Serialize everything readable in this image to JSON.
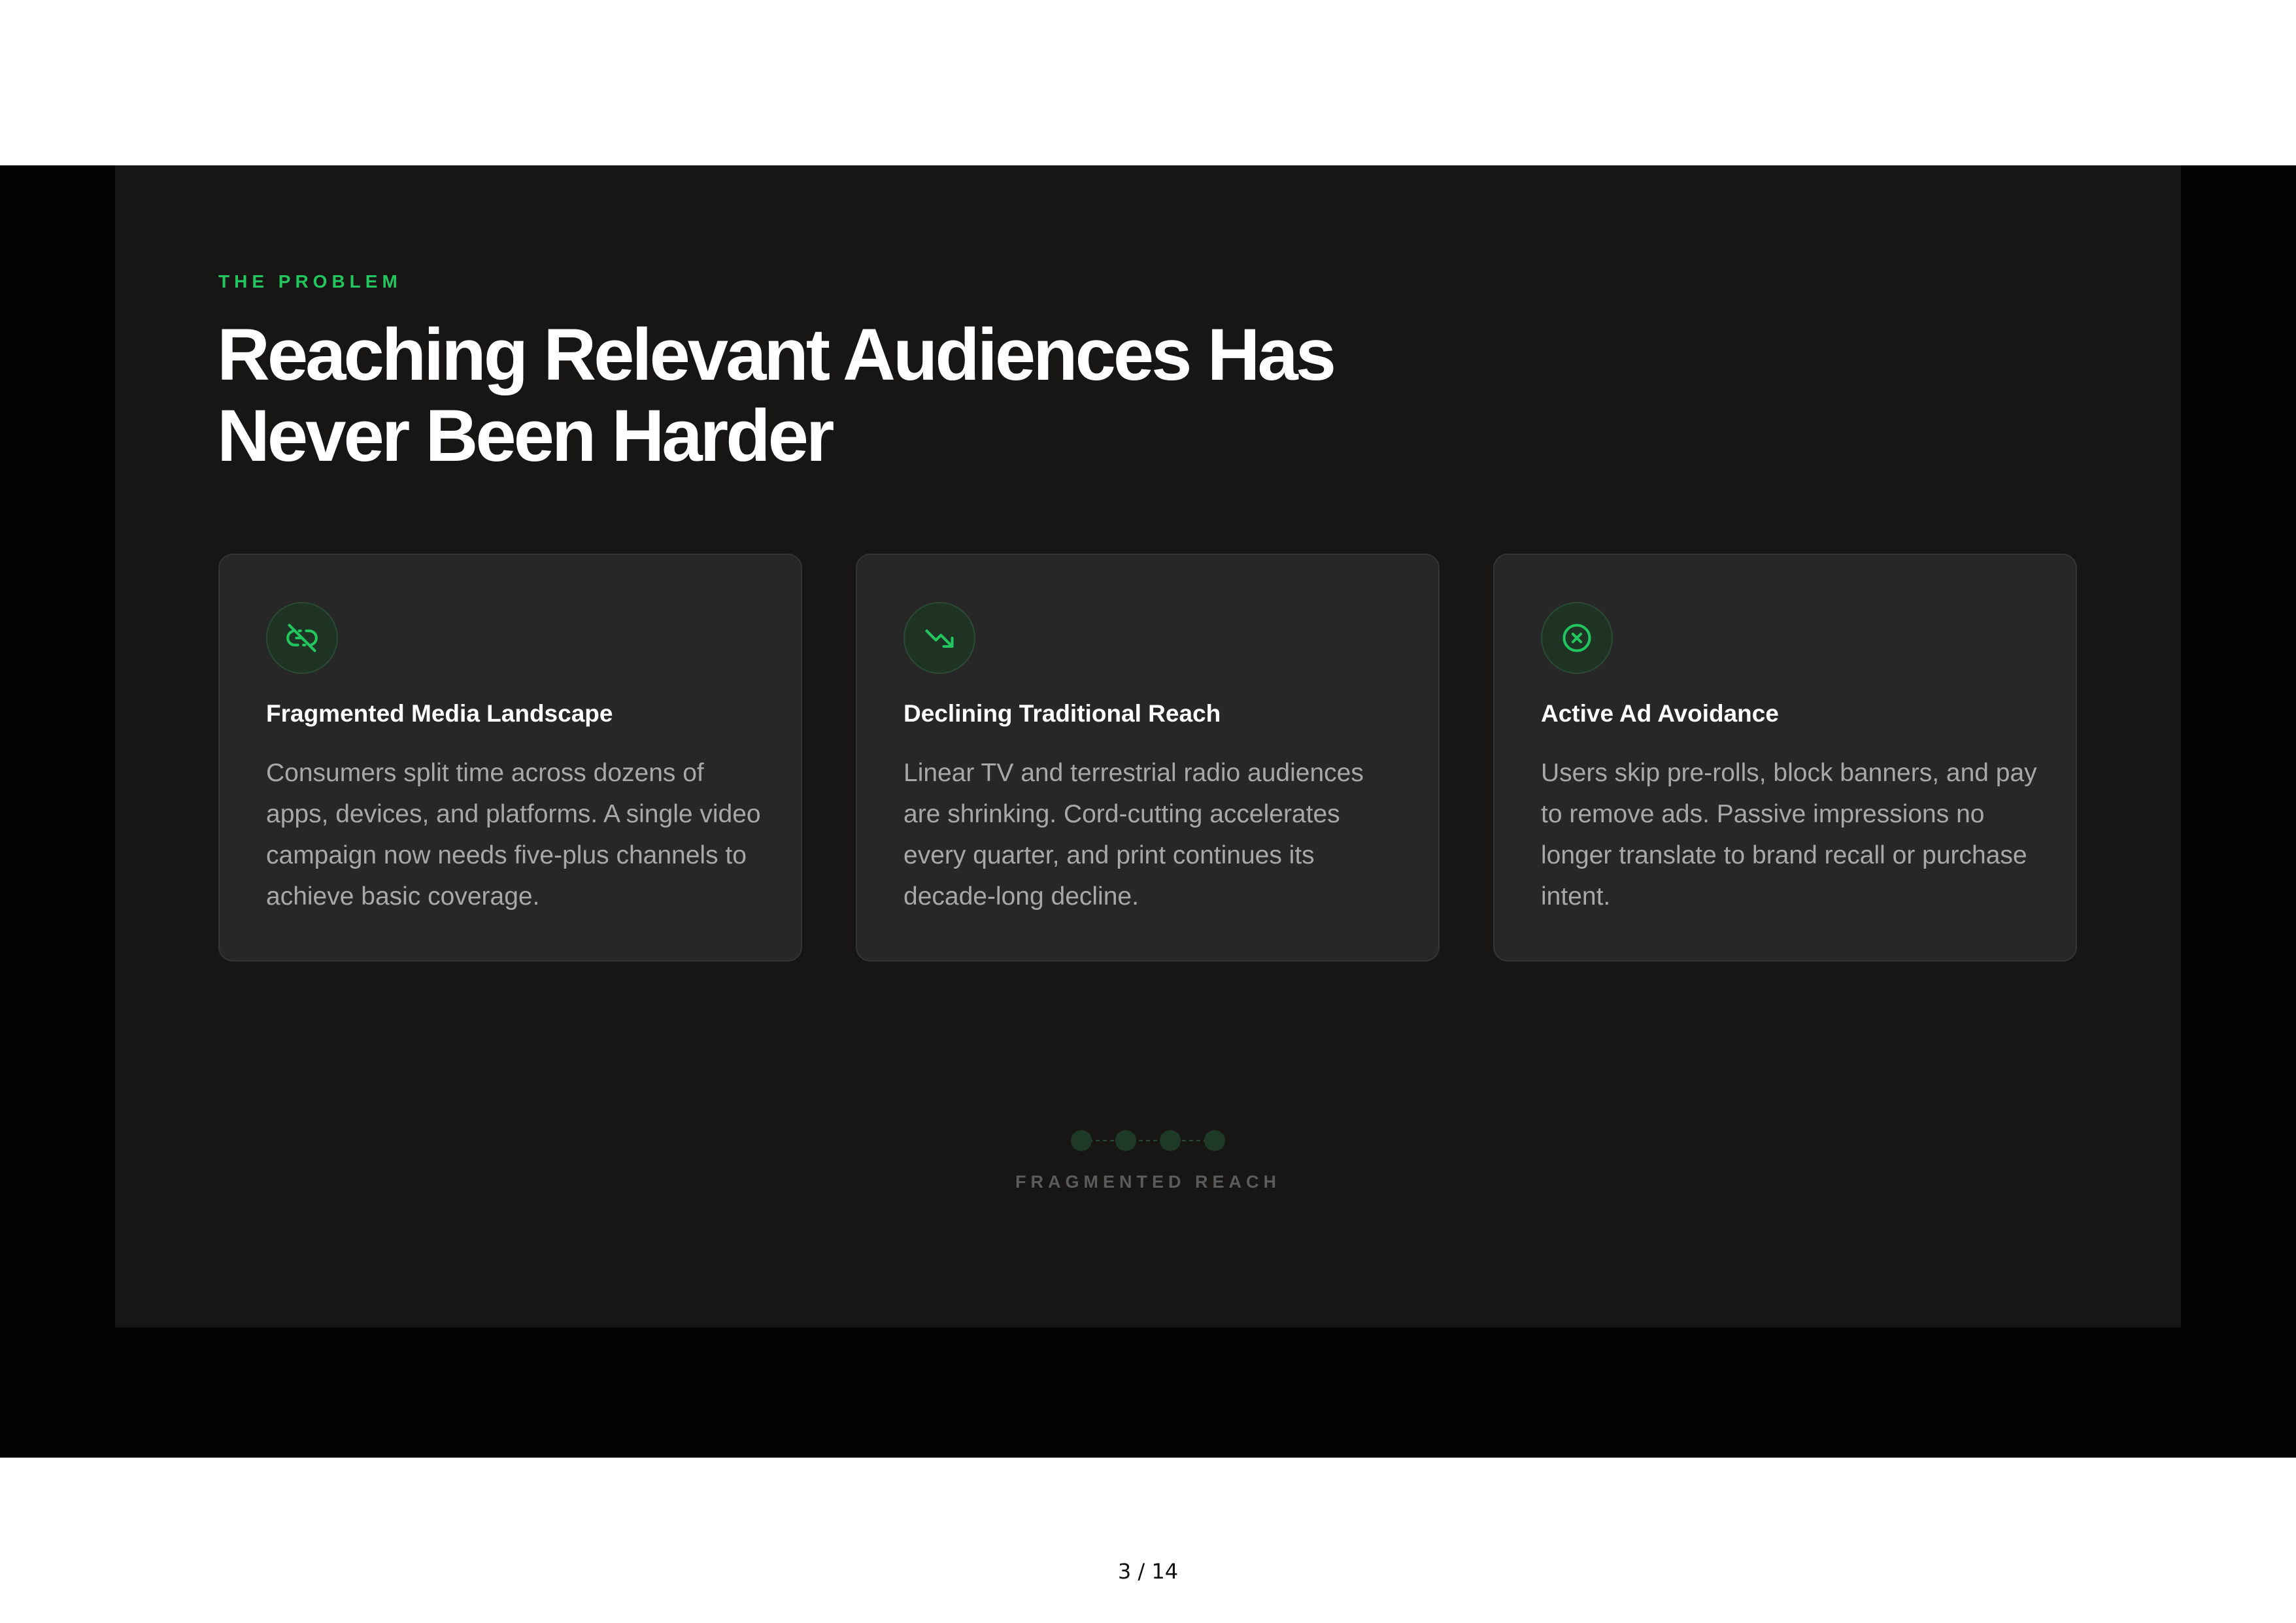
{
  "slide": {
    "eyebrow": "THE PROBLEM",
    "title": "Reaching Relevant Audiences Has Never Been Harder",
    "cards": [
      {
        "icon": "broken-link-icon",
        "title": "Fragmented Media Landscape",
        "body": "Consumers split time across dozens of apps, devices, and platforms. A single video campaign now needs five-plus channels to achieve basic coverage."
      },
      {
        "icon": "trending-down-icon",
        "title": "Declining Traditional Reach",
        "body": "Linear TV and terrestrial radio audiences are shrinking. Cord-cutting accelerates every quarter, and print continues its decade-long decline."
      },
      {
        "icon": "x-circle-icon",
        "title": "Active Ad Avoidance",
        "body": "Users skip pre-rolls, block banners, and pay to remove ads. Passive impressions no longer translate to brand recall or purchase intent."
      }
    ],
    "progress": {
      "label": "FRAGMENTED REACH",
      "steps": 4
    }
  },
  "viewer": {
    "page_indicator": "3 / 14"
  },
  "colors": {
    "accent": "#22c55e",
    "slide_background": "#181615",
    "card_background": "#272727",
    "letterbox": "#040404"
  }
}
